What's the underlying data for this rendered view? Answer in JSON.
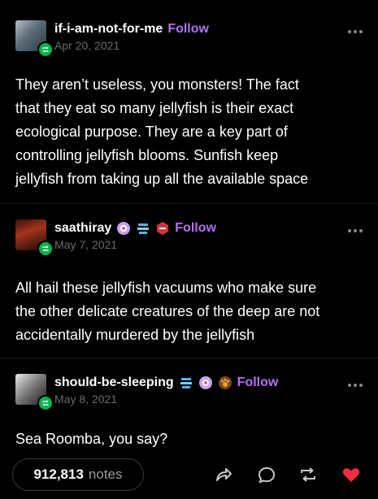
{
  "colors": {
    "background": "#000000",
    "follow": "#b66ff0",
    "reblog_badge": "#00b34d",
    "heart": "#ff2a3d",
    "muted": "#6b6b6b"
  },
  "posts": [
    {
      "username": "if-i-am-not-for-me",
      "follow_label": "Follow",
      "date": "Apr 20, 2021",
      "lines": [
        "They aren’t useless, you monsters! The fact",
        "that they eat so many jellyfish is their exact",
        "ecological purpose. They are a key part of",
        "controlling jellyfish blooms. Sunfish keep",
        "jellyfish from taking up all the available space"
      ]
    },
    {
      "username": "saathiray",
      "follow_label": "Follow",
      "date": "May 7, 2021",
      "badges": [
        "purple-flower-badge-icon",
        "blue-stack-badge-icon",
        "red-hexagon-badge-icon"
      ],
      "lines": [
        "All hail these jellyfish vacuums who make sure",
        "the other delicate creatures of the deep are not",
        "accidentally murdered by the jellyfish"
      ]
    },
    {
      "username": "should-be-sleeping",
      "follow_label": "Follow",
      "date": "May 8, 2021",
      "badges": [
        "blue-stack-badge-icon",
        "purple-flower-badge-icon",
        "orange-paw-badge-icon"
      ],
      "lines": [
        "Sea Roomba, you say?"
      ]
    }
  ],
  "footer": {
    "notes_count": "912,813",
    "notes_label": "notes",
    "icons": [
      "share-icon",
      "reply-icon",
      "reblog-icon",
      "like-heart-icon"
    ]
  }
}
